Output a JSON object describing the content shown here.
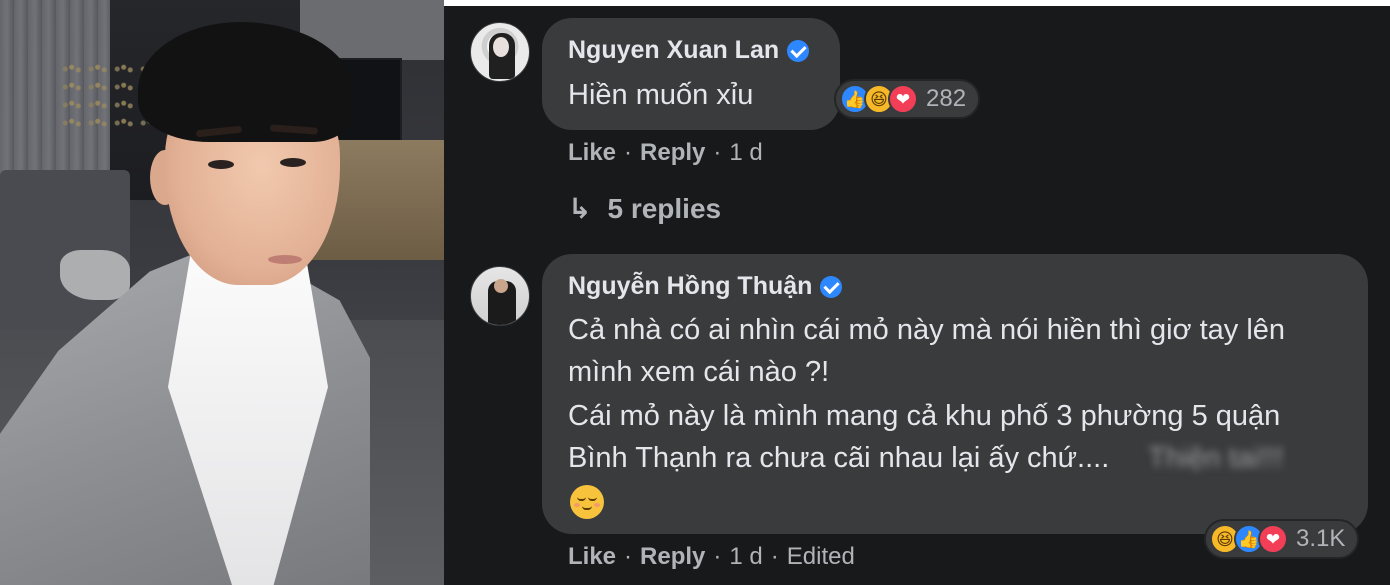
{
  "comments": [
    {
      "author": "Nguyen Xuan Lan",
      "verified": true,
      "lines": [
        "Hiền muốn xỉu"
      ],
      "reactions": {
        "icons": [
          "like-icon",
          "haha-icon",
          "love-icon"
        ],
        "count": "282"
      },
      "actions": {
        "like": "Like",
        "reply": "Reply",
        "time": "1 d"
      },
      "replies_label": "5 replies"
    },
    {
      "author": "Nguyễn Hồng Thuận",
      "verified": true,
      "lines": [
        "Cả nhà có ai nhìn cái mỏ này mà nói hiền thì giơ tay lên",
        "mình xem cái nào ?!",
        "Cái mỏ này là mình mang cả khu phố 3 phường 5 quận",
        "Bình Thạnh ra chưa cãi nhau lại ấy chứ...."
      ],
      "blurred_text": "Thiện tai!!!",
      "emoji": "relieved-face-emoji",
      "reactions": {
        "icons": [
          "haha-icon",
          "like-icon",
          "love-icon"
        ],
        "count": "3.1K"
      },
      "actions": {
        "like": "Like",
        "reply": "Reply",
        "time": "1 d",
        "edited": "Edited"
      }
    }
  ],
  "colors": {
    "background": "#18191a",
    "bubble": "#3a3b3c",
    "text": "#e4e6eb",
    "secondary_text": "#b0b3b8",
    "verified": "#2d88ff",
    "like": "#2d88ff",
    "haha": "#f7b928",
    "love": "#f33e58"
  }
}
